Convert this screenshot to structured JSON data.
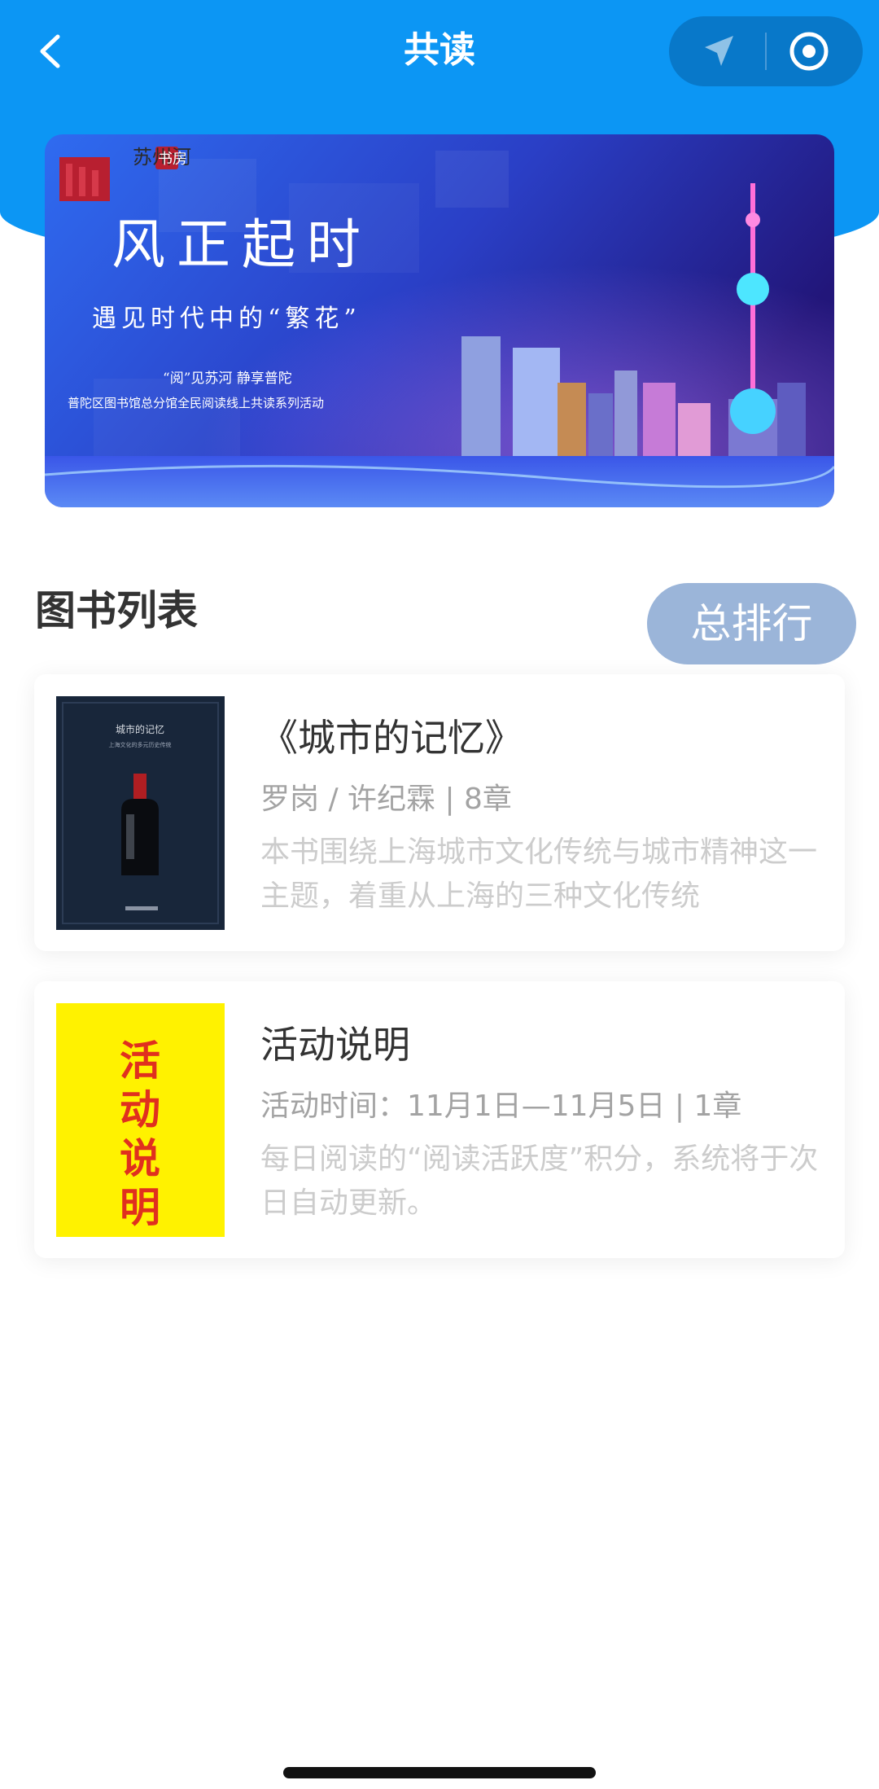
{
  "nav": {
    "title": "共读"
  },
  "banner": {
    "logo_text": "苏州河",
    "logo_badge": "书房",
    "headline": "风正起时",
    "subheadline": "遇见时代中的“繁花”",
    "tagline1": "“阅”见苏河  静享普陀",
    "tagline2": "普陀区图书馆总分馆全民阅读线上共读系列活动"
  },
  "section": {
    "title": "图书列表",
    "rank_button": "总排行"
  },
  "books": [
    {
      "title": "《城市的记忆》",
      "meta": "罗岗 / 许纪霖 | 8章",
      "description": "本书围绕上海城市文化传统与城市精神这一主题，着重从上海的三种文化传统",
      "cover_title": "城市的记忆",
      "cover_subtitle": "上海文化的多元历史传统"
    },
    {
      "title": "活动说明",
      "meta": "活动时间：11月1日—11月5日 | 1章",
      "description": "每日阅读的“阅读活跃度”积分，系统将于次日自动更新。",
      "cover_chars": [
        "活",
        "动",
        "说",
        "明"
      ]
    }
  ],
  "colors": {
    "primary": "#0c96f4",
    "rank_button": "#9bb5d9",
    "activity_cover_bg": "#fff200",
    "activity_cover_text": "#e0301e"
  }
}
